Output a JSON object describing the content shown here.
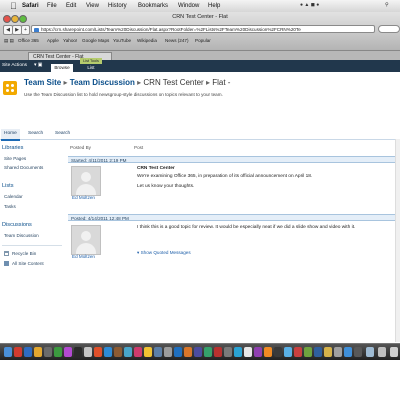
{
  "menubar": {
    "app": "Safari",
    "items": [
      "File",
      "Edit",
      "View",
      "History",
      "Bookmarks",
      "Window",
      "Help"
    ]
  },
  "window": {
    "title": "CRN Test Center - Flat"
  },
  "browser": {
    "url": "https://crn.sharepoint.com/Lists/Team%20Discussion/Flat.aspx?RootFolder=%2FLists%2FTeam%20Discussion%2FCRN%20Te",
    "bookmarks": [
      "Office 365",
      "Apple",
      "Yahoo!",
      "Google Maps",
      "YouTube",
      "Wikipedia",
      "News (247)",
      "Popular"
    ],
    "tab_label": "CRN Test Center - Flat"
  },
  "ribbon": {
    "site_actions": "Site Actions",
    "context_group": "List Tools",
    "tab_browse": "Browse",
    "tab_list": "List"
  },
  "page": {
    "breadcrumb": [
      "Team Site",
      "Team Discussion",
      "CRN Test Center",
      "Flat"
    ],
    "description": "Use the Team Discussion list to hold newsgroup-style discussions on topics relevant to your team."
  },
  "topnav": [
    "Home",
    "Search",
    "Search"
  ],
  "quicklaunch": {
    "libraries_heading": "Libraries",
    "libraries": [
      "Site Pages",
      "Shared Documents"
    ],
    "lists_heading": "Lists",
    "lists": [
      "Calendar",
      "Tasks"
    ],
    "discussions_heading": "Discussions",
    "discussions": [
      "Team Discussion"
    ],
    "recycle_bin": "Recycle Bin",
    "all_site_content": "All Site Content"
  },
  "thread": {
    "col_posted_by": "Posted By",
    "col_post": "Post",
    "posts": [
      {
        "started": "Started: 4/11/2011 2:19 PM",
        "author": "Ed Moltzen",
        "subject": "CRN Test Center",
        "body": "We're examining Office 365, in preparation of its official announcement on April 18.",
        "body2": "Let us know your thoughts."
      },
      {
        "started": "Posted: 4/14/2011 12:48 PM",
        "author": "Ed Moltzen",
        "body": "I think this is a good topic for review. It would be especially neat if we did a slide show and video with it.",
        "show_quoted": "Show Quoted Messages"
      }
    ]
  },
  "colors": {
    "ribbon": "#21374c",
    "link": "#0a4e8a",
    "post_bar": "#e4eef8",
    "logo": "#f2a900"
  }
}
